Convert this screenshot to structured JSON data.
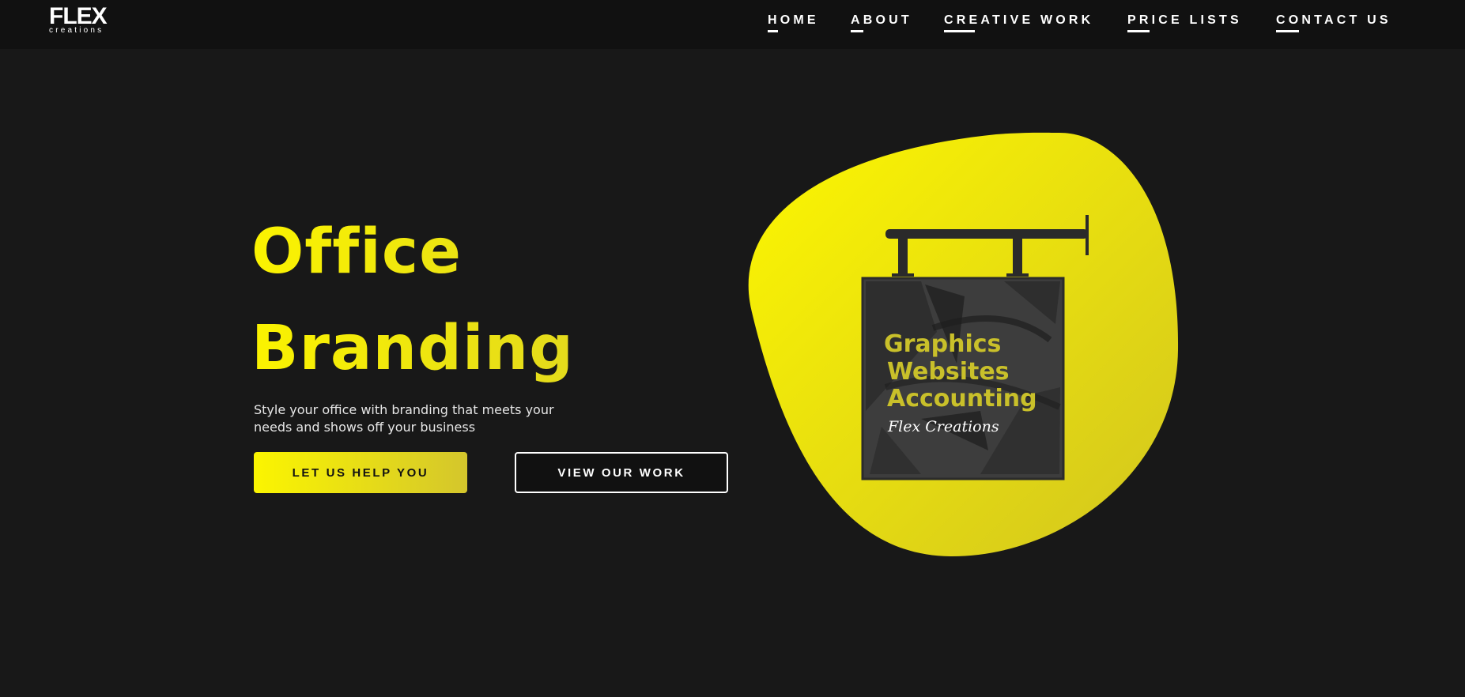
{
  "header": {
    "logo": {
      "main": "FLEX",
      "sub": "creations"
    },
    "nav": [
      {
        "label": "HOME"
      },
      {
        "label": "ABOUT"
      },
      {
        "label": "CREATIVE WORK"
      },
      {
        "label": "PRICE LISTS"
      },
      {
        "label": "CONTACT US"
      }
    ]
  },
  "hero": {
    "title_line1": "Office",
    "title_line2": "Branding",
    "description": "Style your office with branding that meets your needs and shows off your business",
    "primary_button": "LET US HELP YOU",
    "secondary_button": "VIEW OUR WORK"
  },
  "sign": {
    "line1": "Graphics",
    "line2": "Websites",
    "line3": "Accounting",
    "signature": "Flex Creations"
  },
  "colors": {
    "background": "#181818",
    "header_background": "#111111",
    "accent_yellow": "#f5ef0f",
    "sign_text": "#c9c02a",
    "text_white": "#ffffff"
  },
  "icons": {
    "blob": "yellow-blob-shape",
    "sign": "hanging-sign-icon"
  }
}
